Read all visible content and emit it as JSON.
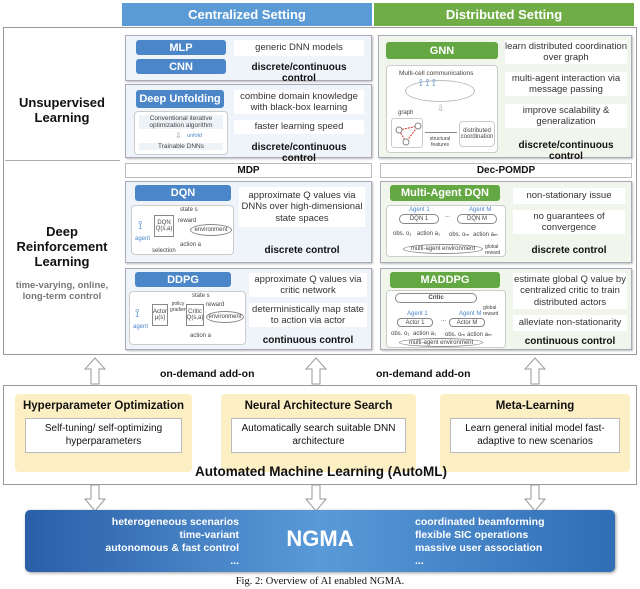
{
  "headers": {
    "centralized": "Centralized Setting",
    "distributed": "Distributed Setting"
  },
  "left": {
    "unsupervised": "Unsupervised Learning",
    "drl": "Deep Reinforcement Learning",
    "drl_sub": "time-varying, online, long-term control"
  },
  "unsup_central": {
    "mlp": "MLP",
    "cnn": "CNN",
    "mlp_note": "generic DNN models",
    "mlp_ctrl": "discrete/continuous control",
    "du": "Deep Unfolding",
    "du_diagram": {
      "top": "Conventional iterative optimization algorithm",
      "arrow": "unfold",
      "bottom": "Trainable DNNs"
    },
    "du_notes": [
      "combine domain knowledge with black-box learning",
      "faster learning speed"
    ],
    "du_ctrl": "discrete/continuous control"
  },
  "unsup_dist": {
    "gnn": "GNN",
    "diagram": {
      "title": "Multi-cell communications",
      "graph": "graph",
      "edge": "structural features",
      "target": "distributed coordination"
    },
    "notes": [
      "learn distributed coordination over graph",
      "multi-agent interaction via message passing",
      "improve scalability & generalization"
    ],
    "ctrl": "discrete/continuous control"
  },
  "mdp": "MDP",
  "decpomdp": "Dec-POMDP",
  "dqn": {
    "title": "DQN",
    "diagram": {
      "state": "state s",
      "net": "DQN Q(s,a)",
      "reward": "reward",
      "env": "environment",
      "agent": "agent",
      "action": "action a",
      "sel": "selection"
    },
    "note": "approximate Q values via DNNs over high-dimensional state spaces",
    "ctrl": "discrete control"
  },
  "ddpg": {
    "title": "DDPG",
    "diagram": {
      "state": "state s",
      "actor": "Actor μ(s)",
      "pg": "policy gradient",
      "critic": "Critic Q(s,a)",
      "reward": "reward",
      "env": "environment",
      "agent": "agent",
      "action": "action a"
    },
    "notes": [
      "approximate Q values via critic network",
      "deterministically map state to action via actor"
    ],
    "ctrl": "continuous control"
  },
  "madqn": {
    "title": "Multi-Agent DQN",
    "diagram": {
      "agent1": "Agent 1",
      "agentM": "Agent M",
      "dqn1": "DQN 1",
      "dqnM": "DQN M",
      "obs1": "obs. o₁",
      "act1": "action a₁",
      "obsM": "obs. oₘ",
      "actM": "action aₘ",
      "env": "multi-agent environment",
      "reward": "global reward",
      "dots": "..."
    },
    "notes": [
      "non-stationary issue",
      "no guarantees of convergence"
    ],
    "ctrl": "discrete control"
  },
  "maddpg": {
    "title": "MADDPG",
    "diagram": {
      "critic": "Critic",
      "agent1": "Agent 1",
      "agentM": "Agent M",
      "actor1": "Actor 1",
      "actorM": "Actor M",
      "obs1": "obs. o₁",
      "act1": "action a₁",
      "obsM": "obs. oₘ",
      "actM": "action aₘ",
      "env": "multi-agent environment",
      "reward": "global reward",
      "dots": "..."
    },
    "notes": [
      "estimate global Q value by centralized critic to train distributed actors",
      "alleviate non-stationarity"
    ],
    "ctrl": "continuous control"
  },
  "addon": [
    "on-demand add-on",
    "on-demand add-on"
  ],
  "automl": {
    "title": "Automated Machine Learning (AutoML)",
    "items": [
      {
        "title": "Hyperparameter Optimization",
        "note": "Self-tuning/ self-optimizing hyperparameters"
      },
      {
        "title": "Neural Architecture Search",
        "note": "Automatically search suitable DNN architecture"
      },
      {
        "title": "Meta-Learning",
        "note": "Learn general initial model fast-adaptive to new scenarios"
      }
    ]
  },
  "ngma": {
    "title": "NGMA",
    "left": [
      "heterogeneous scenarios",
      "time-variant",
      "autonomous & fast control",
      "..."
    ],
    "right": [
      "coordinated beamforming",
      "flexible SIC operations",
      "massive user association",
      "..."
    ]
  },
  "caption": "Fig. 2: Overview of AI enabled NGMA.",
  "colors": {
    "central": "#5b9bd5",
    "distributed": "#70ad47",
    "automl": "#fcefc4",
    "ngma": "#2f6db5"
  }
}
